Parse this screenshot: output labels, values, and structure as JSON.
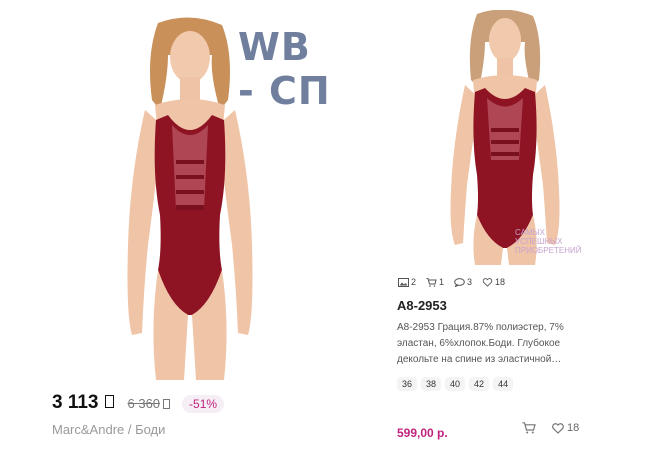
{
  "watermark": "WB - СП",
  "left_card": {
    "price_current": "3 113",
    "price_old": "6 360",
    "discount": "-51%",
    "brand_line": "Marc&Andre / Боди"
  },
  "right_card": {
    "stats": {
      "photos": "2",
      "cart": "1",
      "comments": "3",
      "likes": "18"
    },
    "article": "A8-2953",
    "description_lines": [
      "A8-2953 Грация.87% полиэстер, 7%",
      "эластан, 6%хлопок.Боди. Глубокое",
      "декольте на спине из эластичной…"
    ],
    "sizes": [
      "36",
      "38",
      "40",
      "42",
      "44"
    ],
    "price": "599,00 р.",
    "favorites": "18",
    "shop_watermark_line1": "САМЫХ УСПЕШНЫХ",
    "shop_watermark_line2": "ПРИОБРЕТЕНИЙ"
  },
  "colors": {
    "accent": "#c0237f",
    "bodysuit": "#8e1424",
    "watermark": "#6f7f9d"
  },
  "icons": [
    "image-icon",
    "cart-icon",
    "comment-icon",
    "heart-icon"
  ]
}
